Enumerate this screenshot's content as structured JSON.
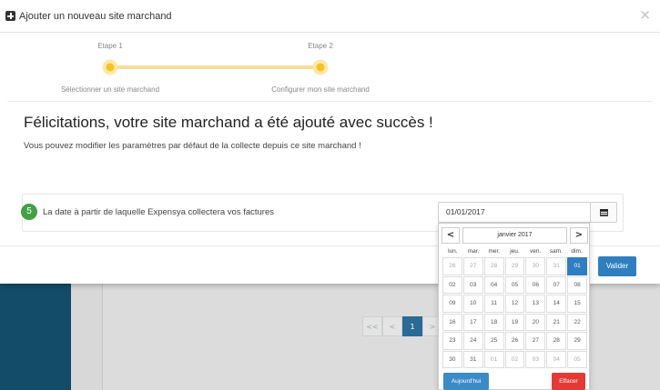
{
  "modal": {
    "title": "Ajouter un nouveau site marchand",
    "close_symbol": "×"
  },
  "steps": [
    {
      "label": "Etape 1",
      "description": "Sélectionner un site marchand"
    },
    {
      "label": "Etape 2",
      "description": "Configurer mon site marchand"
    }
  ],
  "success": {
    "title": "Félicitations, votre site marchand a été ajouté avec succès !",
    "subtitle": "Vous pouvez modifier les paramètres par défaut de la collecte depuis ce site marchand !"
  },
  "date_field": {
    "step_number": "5",
    "label": "La date à partir de laquelle Expensya collectera vos factures",
    "value": "01/01/2017"
  },
  "footer": {
    "validate_label": "Valider"
  },
  "datepicker": {
    "prev": "<",
    "next": ">",
    "month_label": "janvier 2017",
    "weekdays": [
      "lun.",
      "mar.",
      "mer.",
      "jeu.",
      "ven.",
      "sam.",
      "dim."
    ],
    "weeks": [
      [
        "26",
        "27",
        "28",
        "29",
        "30",
        "31",
        "01"
      ],
      [
        "02",
        "03",
        "04",
        "05",
        "06",
        "07",
        "08"
      ],
      [
        "09",
        "10",
        "11",
        "12",
        "13",
        "14",
        "15"
      ],
      [
        "16",
        "17",
        "18",
        "19",
        "20",
        "21",
        "22"
      ],
      [
        "23",
        "24",
        "25",
        "26",
        "27",
        "28",
        "29"
      ],
      [
        "30",
        "31",
        "01",
        "02",
        "03",
        "04",
        "05"
      ]
    ],
    "selected_day": "01",
    "today_label": "Aujourd'hui",
    "clear_label": "Effacer"
  },
  "background_pager": {
    "first": "<<",
    "prev": "<",
    "current": "1",
    "next": ">"
  },
  "colors": {
    "accent_blue": "#2f7fc0",
    "step_yellow": "#f5c323",
    "badge_green": "#43a047",
    "clear_red": "#e53935",
    "sidebar_navy": "#124c69"
  }
}
